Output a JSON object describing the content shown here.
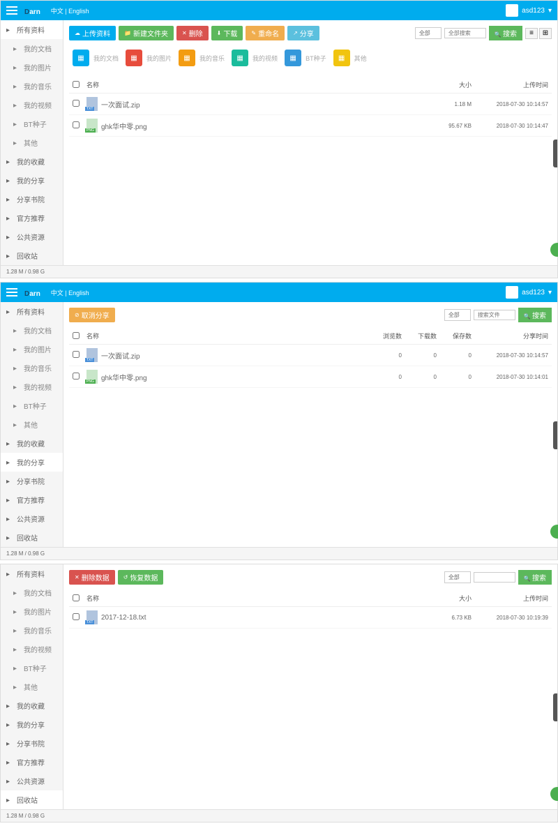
{
  "topbar": {
    "logo": "arn",
    "lang": "中文 | English",
    "user": "asd123"
  },
  "footer": "1.28 M / 0.98 G",
  "p1": {
    "sidebar": [
      {
        "label": "所有资料",
        "active": true
      },
      {
        "label": "我的文档",
        "sub": true
      },
      {
        "label": "我的图片",
        "sub": true
      },
      {
        "label": "我的音乐",
        "sub": true
      },
      {
        "label": "我的视频",
        "sub": true
      },
      {
        "label": "BT种子",
        "sub": true
      },
      {
        "label": "其他",
        "sub": true
      },
      {
        "label": "我的收藏"
      },
      {
        "label": "我的分享"
      },
      {
        "label": "分享书院"
      },
      {
        "label": "官方推荐"
      },
      {
        "label": "公共资源"
      },
      {
        "label": "回收站"
      }
    ],
    "toolbar": {
      "upload": "上传资料",
      "newdir": "新建文件夹",
      "del": "删除",
      "dl": "下载",
      "rename": "重命名",
      "share": "分享",
      "sel": "全部",
      "ph": "全部搜索",
      "search": "搜索"
    },
    "cats": [
      {
        "label": "我的文档",
        "cls": "ci-blue"
      },
      {
        "label": "我的图片",
        "cls": "ci-red"
      },
      {
        "label": "我的音乐",
        "cls": "ci-orange"
      },
      {
        "label": "我的视频",
        "cls": "ci-teal"
      },
      {
        "label": "BT种子",
        "cls": "ci-blue2"
      },
      {
        "label": "其他",
        "cls": "ci-yellow"
      }
    ],
    "cols": {
      "name": "名称",
      "size": "大小",
      "time": "上传时间"
    },
    "rows": [
      {
        "icon": "fi-txt",
        "name": "一次面试.zip",
        "size": "1.18 M",
        "time": "2018-07-30 10:14:57"
      },
      {
        "icon": "fi-png",
        "name": "ghk华中零.png",
        "size": "95.67 KB",
        "time": "2018-07-30 10:14:47"
      }
    ]
  },
  "p2": {
    "sidebar": [
      {
        "label": "所有资料"
      },
      {
        "label": "我的文档",
        "sub": true
      },
      {
        "label": "我的图片",
        "sub": true
      },
      {
        "label": "我的音乐",
        "sub": true
      },
      {
        "label": "我的视频",
        "sub": true
      },
      {
        "label": "BT种子",
        "sub": true
      },
      {
        "label": "其他",
        "sub": true
      },
      {
        "label": "我的收藏"
      },
      {
        "label": "我的分享",
        "active": true
      },
      {
        "label": "分享书院"
      },
      {
        "label": "官方推荐"
      },
      {
        "label": "公共资源"
      },
      {
        "label": "回收站"
      }
    ],
    "toolbar": {
      "cancel": "取消分享",
      "sel": "全部",
      "ph": "搜索文件",
      "search": "搜索"
    },
    "cols": {
      "name": "名称",
      "c1": "浏览数",
      "c2": "下载数",
      "c3": "保存数",
      "time": "分享时间"
    },
    "rows": [
      {
        "icon": "fi-txt",
        "name": "一次面试.zip",
        "c1": "0",
        "c2": "0",
        "c3": "0",
        "time": "2018-07-30 10:14:57"
      },
      {
        "icon": "fi-png",
        "name": "ghk华中零.png",
        "c1": "0",
        "c2": "0",
        "c3": "0",
        "time": "2018-07-30 10:14:01"
      }
    ]
  },
  "p3": {
    "sidebar": [
      {
        "label": "所有资料"
      },
      {
        "label": "我的文档",
        "sub": true
      },
      {
        "label": "我的图片",
        "sub": true
      },
      {
        "label": "我的音乐",
        "sub": true
      },
      {
        "label": "我的视频",
        "sub": true
      },
      {
        "label": "BT种子",
        "sub": true
      },
      {
        "label": "其他",
        "sub": true
      },
      {
        "label": "我的收藏"
      },
      {
        "label": "我的分享"
      },
      {
        "label": "分享书院"
      },
      {
        "label": "官方推荐"
      },
      {
        "label": "公共资源"
      },
      {
        "label": "回收站",
        "active": true
      }
    ],
    "toolbar": {
      "del": "删除数据",
      "restore": "恢复数据",
      "sel": "全部",
      "search": "搜索"
    },
    "cols": {
      "name": "名称",
      "size": "大小",
      "time": "上传时间"
    },
    "rows": [
      {
        "icon": "fi-txt",
        "name": "2017-12-18.txt",
        "size": "6.73 KB",
        "time": "2018-07-30 10:19:39"
      }
    ]
  }
}
